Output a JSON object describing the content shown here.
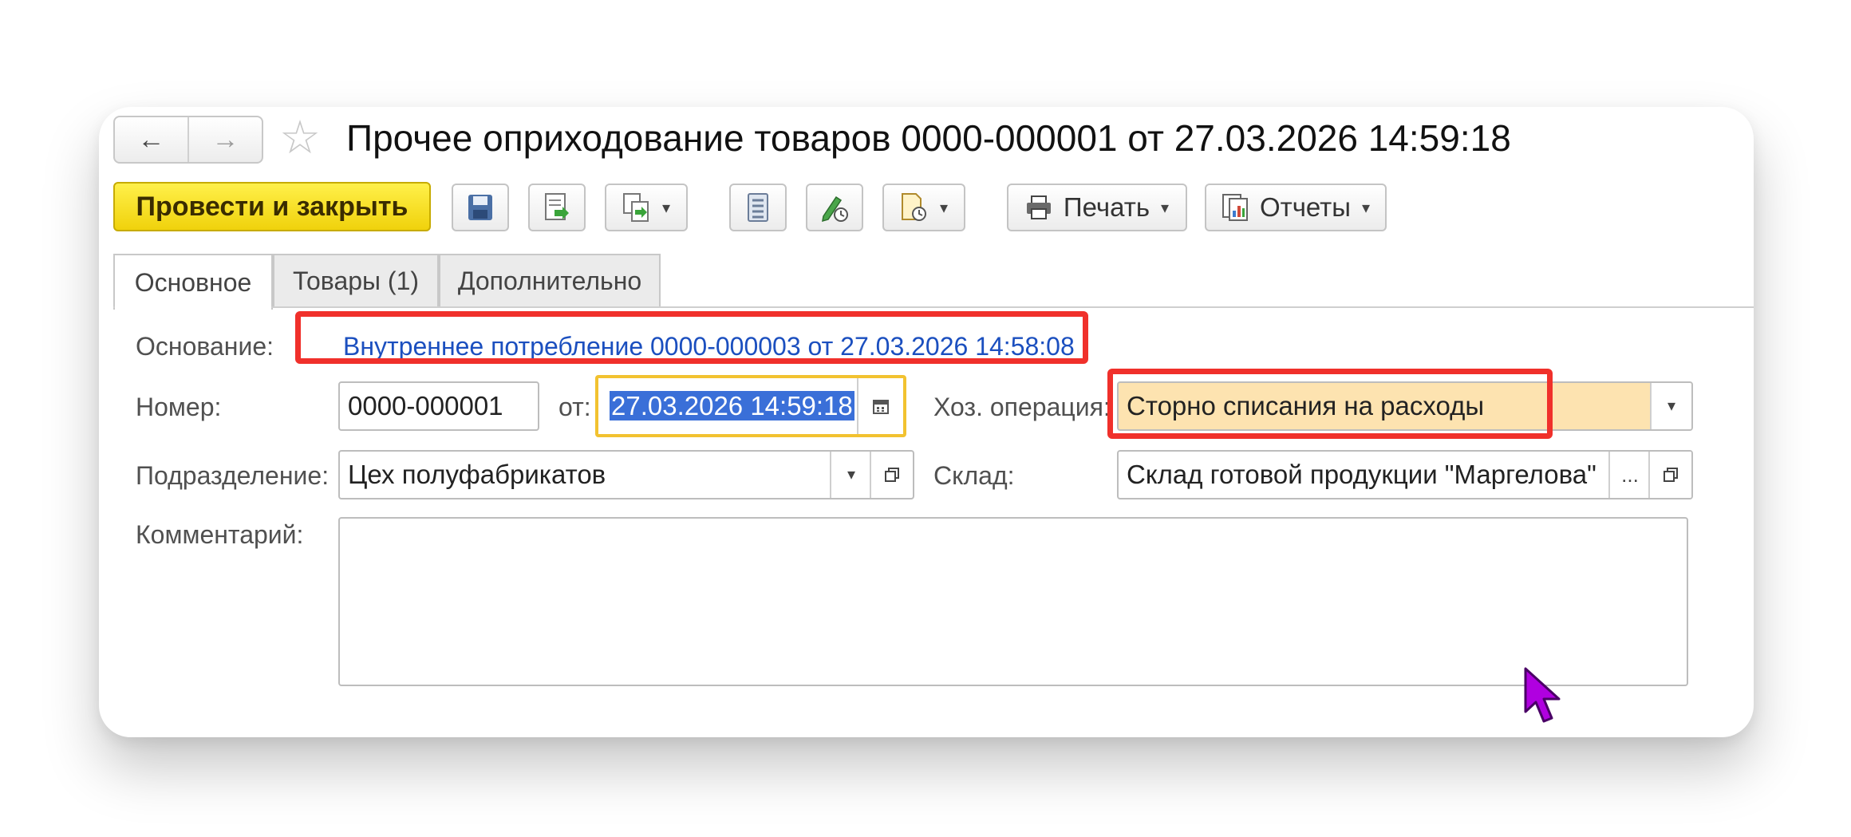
{
  "window": {
    "title": "Прочее оприходование товаров 0000-000001 от 27.03.2026 14:59:18",
    "nav_back": "←",
    "nav_forward": "→",
    "favorite_star": "☆"
  },
  "toolbar": {
    "post_and_close": "Провести и закрыть",
    "print": "Печать",
    "reports": "Отчеты",
    "dropdown_glyph": "▾",
    "icons": [
      "save-icon",
      "post-icon",
      "create-based-on-icon",
      "document-list-icon",
      "edit-history-icon",
      "attachments-icon",
      "printer-icon",
      "reports-icon"
    ]
  },
  "tabs": [
    {
      "label": "Основное",
      "active": true
    },
    {
      "label": "Товары (1)",
      "active": false
    },
    {
      "label": "Дополнительно",
      "active": false
    }
  ],
  "form": {
    "basis_label": "Основание:",
    "basis_link": "Внутреннее потребление 0000-000003 от 27.03.2026 14:58:08",
    "number_label": "Номер:",
    "number_value": "0000-000001",
    "date_from_label": "от:",
    "date_value": "27.03.2026 14:59:18",
    "operation_label": "Хоз. операция:",
    "operation_value": "Сторно списания на расходы",
    "department_label": "Подразделение:",
    "department_value": "Цех полуфабрикатов",
    "warehouse_label": "Склад:",
    "warehouse_value": "Склад готовой продукции \"Маргелова\"",
    "ellipsis": "...",
    "comment_label": "Комментарий:",
    "comment_value": ""
  },
  "colors": {
    "primary_button": "#f5dc16",
    "highlight_box": "#f0302b",
    "date_focus": "#f2c230",
    "operation_bg": "#fde3b0",
    "link": "#1b4fbf",
    "cursor": "#b000e0"
  }
}
